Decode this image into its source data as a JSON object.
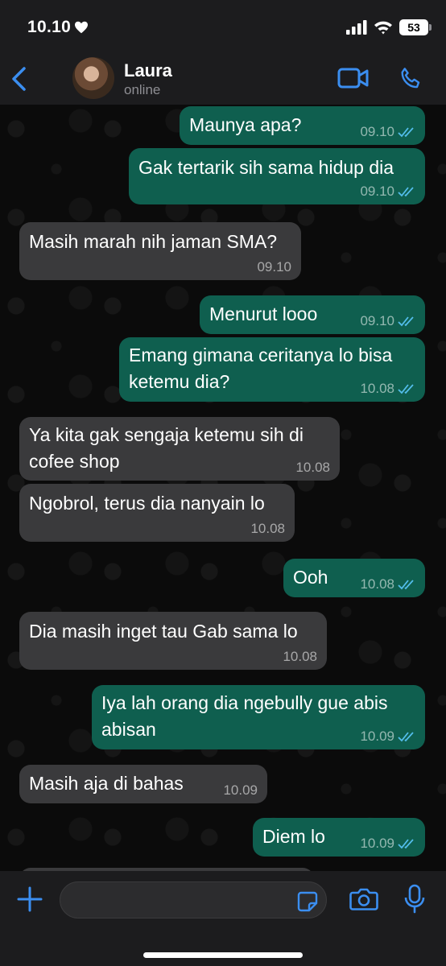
{
  "status_bar": {
    "time": "10.10",
    "battery": "53"
  },
  "header": {
    "name": "Laura",
    "status": "online"
  },
  "messages": [
    {
      "dir": "out",
      "text": "Maunya apa?",
      "time": "09.10"
    },
    {
      "dir": "out",
      "text": "Gak tertarik sih sama hidup dia",
      "time": "09.10"
    },
    {
      "dir": "in",
      "text": "Masih marah nih jaman SMA?",
      "time": "09.10"
    },
    {
      "dir": "out",
      "text": "Menurut looo",
      "time": "09.10"
    },
    {
      "dir": "out",
      "text": "Emang gimana ceritanya lo bisa ketemu dia?",
      "time": "10.08"
    },
    {
      "dir": "in",
      "text": "Ya kita gak sengaja ketemu sih di cofee shop",
      "time": "10.08"
    },
    {
      "dir": "in",
      "text": "Ngobrol, terus dia nanyain lo",
      "time": "10.08"
    },
    {
      "dir": "out",
      "text": "Ooh",
      "time": "10.08"
    },
    {
      "dir": "in",
      "text": "Dia masih inget tau Gab sama lo",
      "time": "10.08"
    },
    {
      "dir": "out",
      "text": "Iya lah orang dia ngebully gue abis abisan",
      "time": "10.09"
    },
    {
      "dir": "in",
      "text": "Masih aja di bahas",
      "time": "10.09"
    },
    {
      "dir": "out",
      "text": "Diem lo",
      "time": "10.09"
    }
  ],
  "colors": {
    "accent": "#3b8ef0",
    "outgoing": "#0f5f4f",
    "incoming": "#3a3a3c",
    "read_ticks": "#53bdeb"
  }
}
